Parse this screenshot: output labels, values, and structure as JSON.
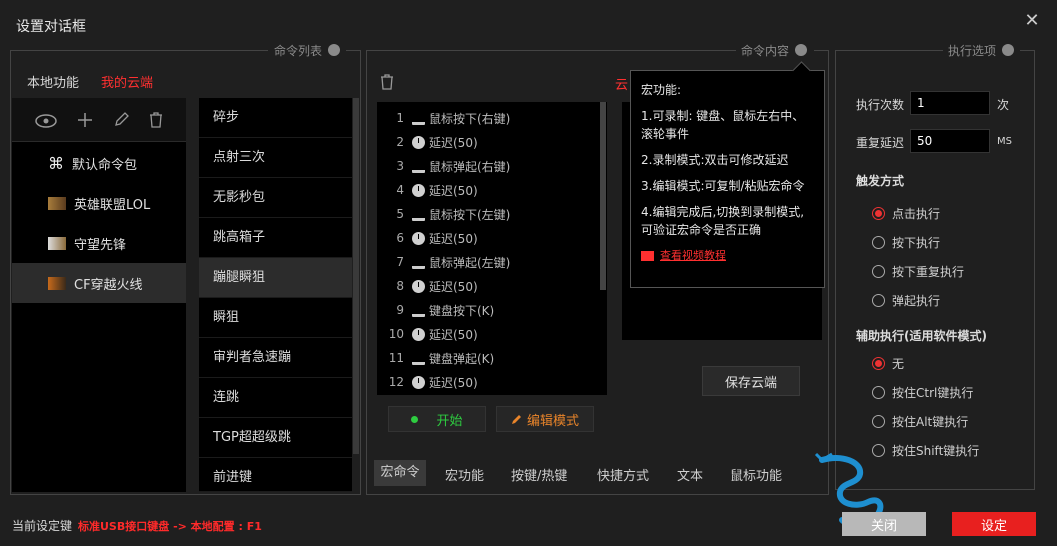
{
  "window": {
    "title": "设置对话框",
    "close_glyph": "✕"
  },
  "command_list": {
    "section_title": "命令列表",
    "tabs": [
      "本地功能",
      "我的云端"
    ],
    "packages": [
      {
        "label": "默认命令包",
        "icon": "command-key-icon"
      },
      {
        "label": "英雄联盟LOL",
        "icon": "lol-game-icon"
      },
      {
        "label": "守望先锋",
        "icon": "overwatch-game-icon"
      },
      {
        "label": "CF穿越火线",
        "icon": "crossfire-game-icon"
      }
    ],
    "commands": [
      "碎步",
      "点射三次",
      "无影秒包",
      "跳高箱子",
      "蹦腿瞬狙",
      "瞬狙",
      "审判者急速蹦",
      "连跳",
      "TGP超超级跳",
      "前进键"
    ]
  },
  "command_content": {
    "section_title": "命令内容",
    "cloud_label": "云",
    "macro_rows": [
      {
        "n": "1",
        "type": "key",
        "text": "鼠标按下(右键)"
      },
      {
        "n": "2",
        "type": "delay",
        "text": "延迟(50)"
      },
      {
        "n": "3",
        "type": "key",
        "text": "鼠标弹起(右键)"
      },
      {
        "n": "4",
        "type": "delay",
        "text": "延迟(50)"
      },
      {
        "n": "5",
        "type": "key",
        "text": "鼠标按下(左键)"
      },
      {
        "n": "6",
        "type": "delay",
        "text": "延迟(50)"
      },
      {
        "n": "7",
        "type": "key",
        "text": "鼠标弹起(左键)"
      },
      {
        "n": "8",
        "type": "delay",
        "text": "延迟(50)"
      },
      {
        "n": "9",
        "type": "key",
        "text": "键盘按下(K)"
      },
      {
        "n": "10",
        "type": "delay",
        "text": "延迟(50)"
      },
      {
        "n": "11",
        "type": "key",
        "text": "键盘弹起(K)"
      },
      {
        "n": "12",
        "type": "delay",
        "text": "延迟(50)"
      }
    ],
    "start_button": "开始",
    "edit_mode_button": "编辑模式",
    "save_cloud_button": "保存云端",
    "bottom_tabs": [
      "宏命令",
      "宏功能",
      "按键/热键",
      "快捷方式",
      "文本",
      "鼠标功能"
    ]
  },
  "tooltip": {
    "title": "宏功能:",
    "item1": "1.可录制: 键盘、鼠标左右中、滚轮事件",
    "item2": "2.录制模式:双击可修改延迟",
    "item3": "3.编辑模式:可复制/粘贴宏命令",
    "item4": "4.编辑完成后,切换到录制模式,可验证宏命令是否正确",
    "link": "查看视频教程"
  },
  "exec_options": {
    "section_title": "执行选项",
    "exec_count_label": "执行次数",
    "exec_count_value": "1",
    "exec_count_unit": "次",
    "repeat_delay_label": "重复延迟",
    "repeat_delay_value": "50",
    "repeat_delay_unit": "MS",
    "trigger_title": "触发方式",
    "trigger_options": [
      "点击执行",
      "按下执行",
      "按下重复执行",
      "弹起执行"
    ],
    "trigger_selected": 0,
    "assist_title": "辅助执行(适用软件模式)",
    "assist_options": [
      "无",
      "按住Ctrl键执行",
      "按住Alt键执行",
      "按住Shift键执行"
    ],
    "assist_selected": 0
  },
  "footer": {
    "current_key_label": "当前设定键",
    "current_key_value": "标准USB接口键盘 -> 本地配置 : F1",
    "close_button": "关闭",
    "confirm_button": "设定"
  },
  "colors": {
    "accent_red": "#e8201f",
    "green": "#2ecc40",
    "orange": "#e8842a"
  }
}
